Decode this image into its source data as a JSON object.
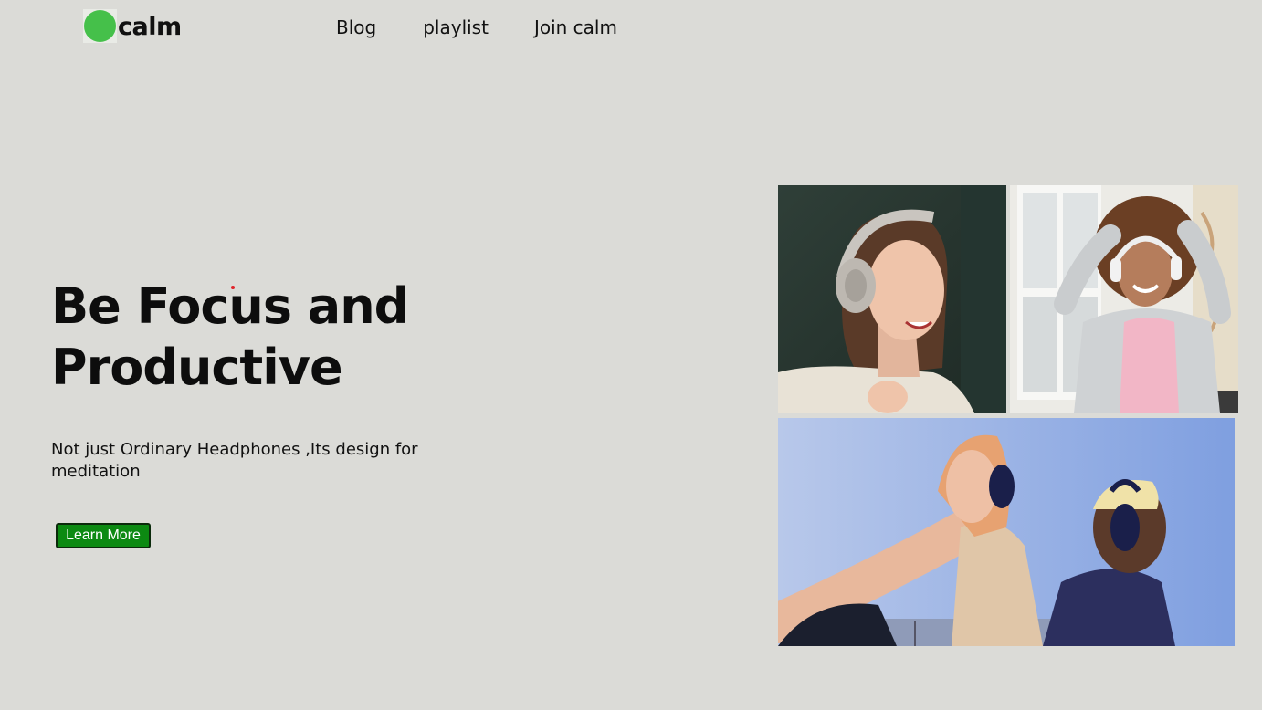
{
  "header": {
    "logo_text": "calm",
    "logo_icon": "green-circle-icon",
    "nav": [
      {
        "label": "Blog"
      },
      {
        "label": "playlist"
      },
      {
        "label": "Join calm"
      }
    ]
  },
  "hero": {
    "title_line1": "Be Focus and",
    "title_line2": "Productive",
    "subtitle": "Not just Ordinary Headphones ,Its design for meditation",
    "cta_label": "Learn More"
  },
  "gallery": {
    "photos": [
      {
        "subject": "woman-headphones-photo"
      },
      {
        "subject": "dancing-woman-headphones-photo"
      },
      {
        "subject": "couple-headphones-photo"
      }
    ]
  },
  "colors": {
    "background": "#dbdbd7",
    "brand_green": "#45c04a",
    "button_green": "#0c8a12"
  }
}
